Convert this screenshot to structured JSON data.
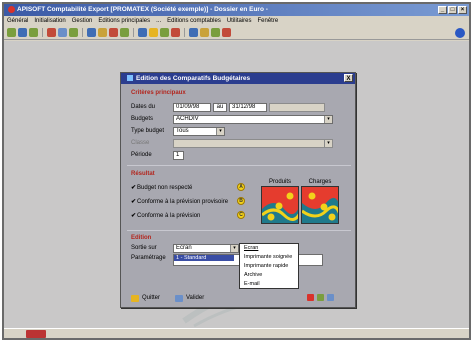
{
  "window": {
    "title": "APISOFT Comptabilité Export [PROMATEX (Société exemple)] - Dossier en Euro -"
  },
  "menu": [
    "Général",
    "Initialisation",
    "Gestion",
    "Editions principales",
    "...",
    "Editions comptables",
    "Utilitaires",
    "Fenêtre"
  ],
  "dialog": {
    "title": "Edition des Comparatifs Budgétaires",
    "close": "X",
    "sections": {
      "criteria": "Critères principaux",
      "display": "Résultat",
      "edition": "Edition"
    },
    "fields": {
      "dates_label": "Dates du",
      "date_from": "01/09/98",
      "date_sep": "au",
      "date_to": "31/12/98",
      "budget_label": "Budgets",
      "budget_value": "ACHDIV",
      "type_label": "Type budget",
      "type_value": "Tous",
      "class_label": "Classe",
      "class_value": "",
      "period_label": "Période",
      "period_value": "1"
    },
    "checks": [
      {
        "label": "Budget non respecté",
        "checked": true,
        "badge": "A"
      },
      {
        "label": "Conforme à la prévision provisoire",
        "checked": true,
        "badge": "B"
      },
      {
        "label": "Conforme à la prévision",
        "checked": true,
        "badge": "C"
      }
    ],
    "panels": {
      "left_label": "Produits",
      "right_label": "Charges"
    },
    "edition": {
      "output_label": "Sortie sur",
      "output_value": "Ecran",
      "setup_label": "Paramétrage",
      "setup_selected": "1 - Standard",
      "options": [
        "Ecran",
        "Imprimante soignée",
        "Imprimante rapide",
        "Archive",
        "E-mail"
      ]
    },
    "buttons": {
      "quit": "Quitter",
      "validate": "Valider"
    }
  },
  "colors": {
    "title_bar": "#3b5aa6",
    "dialog_title": "#2b3d8f",
    "section_red": "#b3261e",
    "badge": "#f2d21b"
  }
}
